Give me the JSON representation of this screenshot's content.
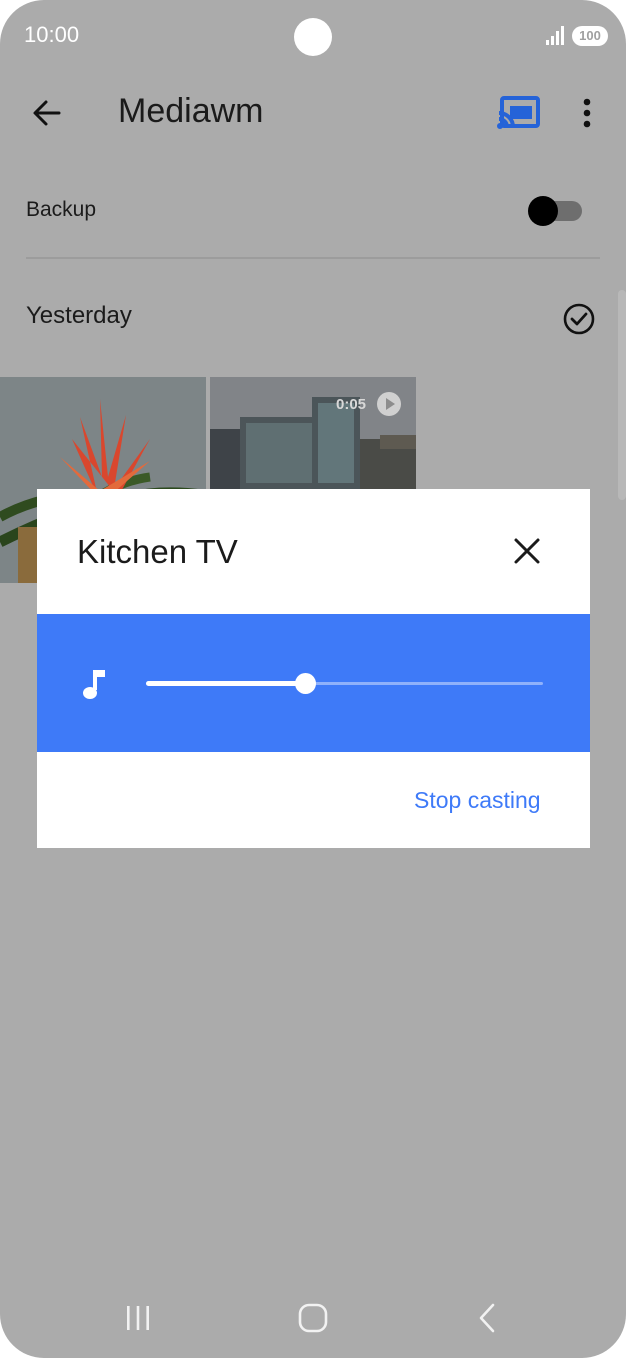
{
  "status_bar": {
    "time": "10:00",
    "battery": "100",
    "icons": [
      "camera-cutout",
      "signal-icon",
      "battery-icon"
    ]
  },
  "app_bar": {
    "title": "Mediawm",
    "icons": [
      "back-arrow-icon",
      "cast-connected-icon",
      "more-vert-icon"
    ],
    "cast_color": "#2563d8"
  },
  "backup": {
    "label": "Backup",
    "enabled": false
  },
  "section": {
    "label": "Yesterday",
    "icon": "check-circle-icon"
  },
  "media": [
    {
      "type": "photo",
      "subject": "flower"
    },
    {
      "type": "video",
      "subject": "buildings",
      "duration": "0:05",
      "icon": "play-icon"
    }
  ],
  "cast_dialog": {
    "title": "Kitchen TV",
    "close_icon": "close-icon",
    "volume_icon": "music-note-icon",
    "volume_level": 0.4,
    "accent_color": "#3e7af8",
    "stop_label": "Stop casting"
  },
  "nav_bar": {
    "icons": [
      "recents-icon",
      "home-icon",
      "back-icon"
    ]
  }
}
